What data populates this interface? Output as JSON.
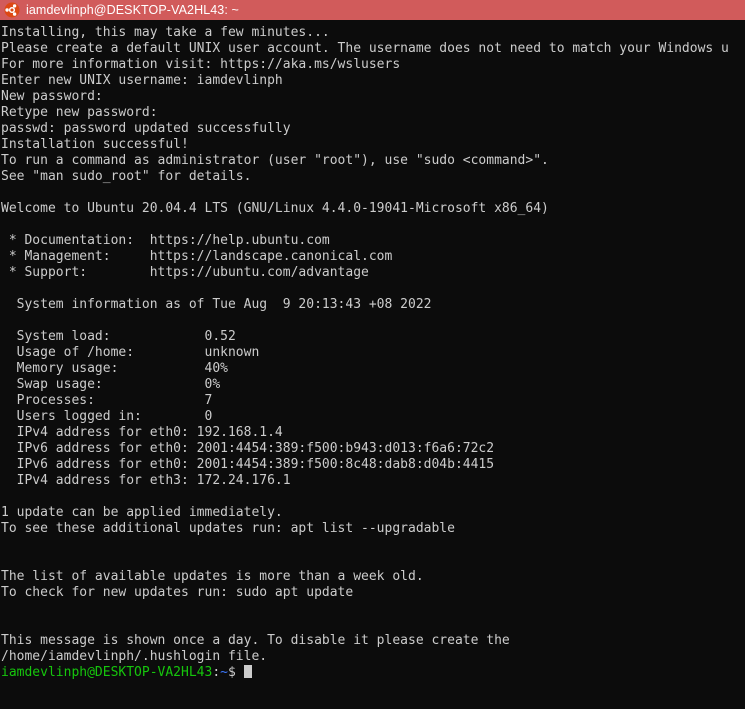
{
  "window": {
    "title": "iamdevlinph@DESKTOP-VA2HL43: ~",
    "logo_icon": "ubuntu-logo-icon",
    "titlebar_color": "#d15b5b",
    "background_color": "#0c0c0c",
    "foreground_color": "#cccccc"
  },
  "terminal": {
    "lines": [
      "Installing, this may take a few minutes...",
      "Please create a default UNIX user account. The username does not need to match your Windows u",
      "For more information visit: https://aka.ms/wslusers",
      "Enter new UNIX username: iamdevlinph",
      "New password:",
      "Retype new password:",
      "passwd: password updated successfully",
      "Installation successful!",
      "To run a command as administrator (user \"root\"), use \"sudo <command>\".",
      "See \"man sudo_root\" for details.",
      "",
      "Welcome to Ubuntu 20.04.4 LTS (GNU/Linux 4.4.0-19041-Microsoft x86_64)",
      "",
      " * Documentation:  https://help.ubuntu.com",
      " * Management:     https://landscape.canonical.com",
      " * Support:        https://ubuntu.com/advantage",
      "",
      "  System information as of Tue Aug  9 20:13:43 +08 2022",
      "",
      "  System load:            0.52",
      "  Usage of /home:         unknown",
      "  Memory usage:           40%",
      "  Swap usage:             0%",
      "  Processes:              7",
      "  Users logged in:        0",
      "  IPv4 address for eth0: 192.168.1.4",
      "  IPv6 address for eth0: 2001:4454:389:f500:b943:d013:f6a6:72c2",
      "  IPv6 address for eth0: 2001:4454:389:f500:8c48:dab8:d04b:4415",
      "  IPv4 address for eth3: 172.24.176.1",
      "",
      "1 update can be applied immediately.",
      "To see these additional updates run: apt list --upgradable",
      "",
      "",
      "The list of available updates is more than a week old.",
      "To check for new updates run: sudo apt update",
      "",
      "",
      "This message is shown once a day. To disable it please create the",
      "/home/iamdevlinph/.hushlogin file."
    ],
    "prompt": {
      "user_host": "iamdevlinph@DESKTOP-VA2HL43",
      "separator": ":",
      "path": "~",
      "symbol": "$",
      "user_host_color": "#16c60c",
      "path_color": "#3b78ff",
      "cursor": "block-cursor"
    }
  }
}
